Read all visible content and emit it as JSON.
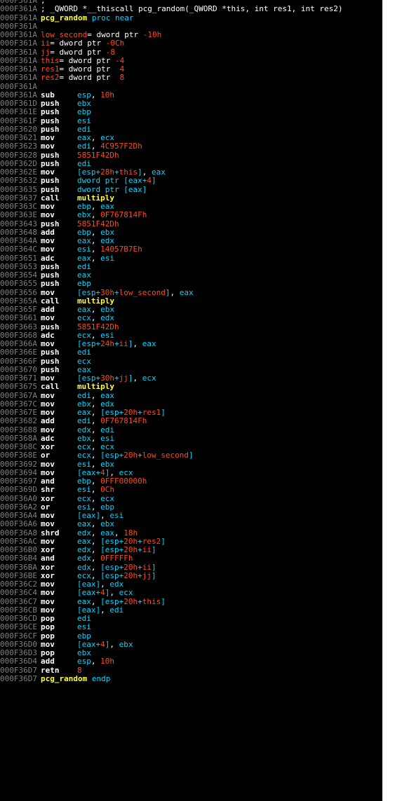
{
  "window": {
    "title": ""
  },
  "colors": {
    "background": "#000000",
    "address": "#808080",
    "mnemonic": "#ffffff",
    "register": "#00d7ff",
    "number": "#ff4a1a",
    "variable": "#ff4a1a",
    "function": "#ffff33"
  },
  "lines": [
    {
      "addr": "000F361A",
      "parts": [
        [
          "txt",
          ";"
        ]
      ]
    },
    {
      "addr": "000F361A",
      "parts": [
        [
          "txt",
          "; _QWORD *__thiscall pcg_random(_QWORD *this, int res1, int res2)"
        ]
      ]
    },
    {
      "addr": "000F361A",
      "parts": [
        [
          "func",
          "pcg_random"
        ],
        [
          "kw",
          " proc near"
        ]
      ]
    },
    {
      "addr": "000F361A",
      "parts": []
    },
    {
      "addr": "000F361A",
      "parts": [
        [
          "var",
          "low_second"
        ],
        [
          "txt",
          "= dword ptr "
        ],
        [
          "num",
          "-10h"
        ]
      ]
    },
    {
      "addr": "000F361A",
      "parts": [
        [
          "var",
          "ii"
        ],
        [
          "txt",
          "= dword ptr "
        ],
        [
          "num",
          "-0Ch"
        ]
      ]
    },
    {
      "addr": "000F361A",
      "parts": [
        [
          "var",
          "jj"
        ],
        [
          "txt",
          "= dword ptr "
        ],
        [
          "num",
          "-8"
        ]
      ]
    },
    {
      "addr": "000F361A",
      "parts": [
        [
          "var",
          "this"
        ],
        [
          "txt",
          "= dword ptr "
        ],
        [
          "num",
          "-4"
        ]
      ]
    },
    {
      "addr": "000F361A",
      "parts": [
        [
          "var",
          "res1"
        ],
        [
          "txt",
          "= dword ptr  "
        ],
        [
          "num",
          "4"
        ]
      ]
    },
    {
      "addr": "000F361A",
      "parts": [
        [
          "var",
          "res2"
        ],
        [
          "txt",
          "= dword ptr  "
        ],
        [
          "num",
          "8"
        ]
      ]
    },
    {
      "addr": "000F361A",
      "parts": []
    },
    {
      "addr": "000F361A",
      "mnem": "sub",
      "ops": [
        [
          "reg",
          "esp"
        ],
        [
          "sep",
          ", "
        ],
        [
          "num",
          "10h"
        ]
      ]
    },
    {
      "addr": "000F361D",
      "mnem": "push",
      "ops": [
        [
          "reg",
          "ebx"
        ]
      ]
    },
    {
      "addr": "000F361E",
      "mnem": "push",
      "ops": [
        [
          "reg",
          "ebp"
        ]
      ]
    },
    {
      "addr": "000F361F",
      "mnem": "push",
      "ops": [
        [
          "reg",
          "esi"
        ]
      ]
    },
    {
      "addr": "000F3620",
      "mnem": "push",
      "ops": [
        [
          "reg",
          "edi"
        ]
      ]
    },
    {
      "addr": "000F3621",
      "mnem": "mov",
      "ops": [
        [
          "reg",
          "eax"
        ],
        [
          "sep",
          ", "
        ],
        [
          "reg",
          "ecx"
        ]
      ]
    },
    {
      "addr": "000F3623",
      "mnem": "mov",
      "ops": [
        [
          "reg",
          "edi"
        ],
        [
          "sep",
          ", "
        ],
        [
          "num",
          "4C957F2Dh"
        ]
      ]
    },
    {
      "addr": "000F3628",
      "mnem": "push",
      "ops": [
        [
          "num",
          "5851F42Dh"
        ]
      ]
    },
    {
      "addr": "000F362D",
      "mnem": "push",
      "ops": [
        [
          "reg",
          "edi"
        ]
      ]
    },
    {
      "addr": "000F362E",
      "mnem": "mov",
      "ops": [
        [
          "reg",
          "[esp+"
        ],
        [
          "num",
          "28h"
        ],
        [
          "reg",
          "+"
        ],
        [
          "var",
          "this"
        ],
        [
          "reg",
          "]"
        ],
        [
          "sep",
          ", "
        ],
        [
          "reg",
          "eax"
        ]
      ]
    },
    {
      "addr": "000F3632",
      "mnem": "push",
      "ops": [
        [
          "reg",
          "dword ptr [eax+"
        ],
        [
          "num",
          "4"
        ],
        [
          "reg",
          "]"
        ]
      ]
    },
    {
      "addr": "000F3635",
      "mnem": "push",
      "ops": [
        [
          "reg",
          "dword ptr [eax]"
        ]
      ]
    },
    {
      "addr": "000F3637",
      "mnem": "call",
      "ops": [
        [
          "func",
          "multiply"
        ]
      ]
    },
    {
      "addr": "000F363C",
      "mnem": "mov",
      "ops": [
        [
          "reg",
          "ebp"
        ],
        [
          "sep",
          ", "
        ],
        [
          "reg",
          "eax"
        ]
      ]
    },
    {
      "addr": "000F363E",
      "mnem": "mov",
      "ops": [
        [
          "reg",
          "ebx"
        ],
        [
          "sep",
          ", "
        ],
        [
          "num",
          "0F767814Fh"
        ]
      ]
    },
    {
      "addr": "000F3643",
      "mnem": "push",
      "ops": [
        [
          "num",
          "5851F42Dh"
        ]
      ]
    },
    {
      "addr": "000F3648",
      "mnem": "add",
      "ops": [
        [
          "reg",
          "ebp"
        ],
        [
          "sep",
          ", "
        ],
        [
          "reg",
          "ebx"
        ]
      ]
    },
    {
      "addr": "000F364A",
      "mnem": "mov",
      "ops": [
        [
          "reg",
          "eax"
        ],
        [
          "sep",
          ", "
        ],
        [
          "reg",
          "edx"
        ]
      ]
    },
    {
      "addr": "000F364C",
      "mnem": "mov",
      "ops": [
        [
          "reg",
          "esi"
        ],
        [
          "sep",
          ", "
        ],
        [
          "num",
          "14057B7Eh"
        ]
      ]
    },
    {
      "addr": "000F3651",
      "mnem": "adc",
      "ops": [
        [
          "reg",
          "eax"
        ],
        [
          "sep",
          ", "
        ],
        [
          "reg",
          "esi"
        ]
      ]
    },
    {
      "addr": "000F3653",
      "mnem": "push",
      "ops": [
        [
          "reg",
          "edi"
        ]
      ]
    },
    {
      "addr": "000F3654",
      "mnem": "push",
      "ops": [
        [
          "reg",
          "eax"
        ]
      ]
    },
    {
      "addr": "000F3655",
      "mnem": "push",
      "ops": [
        [
          "reg",
          "ebp"
        ]
      ]
    },
    {
      "addr": "000F3656",
      "mnem": "mov",
      "ops": [
        [
          "reg",
          "[esp+"
        ],
        [
          "num",
          "30h"
        ],
        [
          "reg",
          "+"
        ],
        [
          "var",
          "low_second"
        ],
        [
          "reg",
          "]"
        ],
        [
          "sep",
          ", "
        ],
        [
          "reg",
          "eax"
        ]
      ]
    },
    {
      "addr": "000F365A",
      "mnem": "call",
      "ops": [
        [
          "func",
          "multiply"
        ]
      ]
    },
    {
      "addr": "000F365F",
      "mnem": "add",
      "ops": [
        [
          "reg",
          "eax"
        ],
        [
          "sep",
          ", "
        ],
        [
          "reg",
          "ebx"
        ]
      ]
    },
    {
      "addr": "000F3661",
      "mnem": "mov",
      "ops": [
        [
          "reg",
          "ecx"
        ],
        [
          "sep",
          ", "
        ],
        [
          "reg",
          "edx"
        ]
      ]
    },
    {
      "addr": "000F3663",
      "mnem": "push",
      "ops": [
        [
          "num",
          "5851F42Dh"
        ]
      ]
    },
    {
      "addr": "000F3668",
      "mnem": "adc",
      "ops": [
        [
          "reg",
          "ecx"
        ],
        [
          "sep",
          ", "
        ],
        [
          "reg",
          "esi"
        ]
      ]
    },
    {
      "addr": "000F366A",
      "mnem": "mov",
      "ops": [
        [
          "reg",
          "[esp+"
        ],
        [
          "num",
          "24h"
        ],
        [
          "reg",
          "+"
        ],
        [
          "var",
          "ii"
        ],
        [
          "reg",
          "]"
        ],
        [
          "sep",
          ", "
        ],
        [
          "reg",
          "eax"
        ]
      ]
    },
    {
      "addr": "000F366E",
      "mnem": "push",
      "ops": [
        [
          "reg",
          "edi"
        ]
      ]
    },
    {
      "addr": "000F366F",
      "mnem": "push",
      "ops": [
        [
          "reg",
          "ecx"
        ]
      ]
    },
    {
      "addr": "000F3670",
      "mnem": "push",
      "ops": [
        [
          "reg",
          "eax"
        ]
      ]
    },
    {
      "addr": "000F3671",
      "mnem": "mov",
      "ops": [
        [
          "reg",
          "[esp+"
        ],
        [
          "num",
          "30h"
        ],
        [
          "reg",
          "+"
        ],
        [
          "var",
          "jj"
        ],
        [
          "reg",
          "]"
        ],
        [
          "sep",
          ", "
        ],
        [
          "reg",
          "ecx"
        ]
      ]
    },
    {
      "addr": "000F3675",
      "mnem": "call",
      "ops": [
        [
          "func",
          "multiply"
        ]
      ]
    },
    {
      "addr": "000F367A",
      "mnem": "mov",
      "ops": [
        [
          "reg",
          "edi"
        ],
        [
          "sep",
          ", "
        ],
        [
          "reg",
          "eax"
        ]
      ]
    },
    {
      "addr": "000F367C",
      "mnem": "mov",
      "ops": [
        [
          "reg",
          "ebx"
        ],
        [
          "sep",
          ", "
        ],
        [
          "reg",
          "edx"
        ]
      ]
    },
    {
      "addr": "000F367E",
      "mnem": "mov",
      "ops": [
        [
          "reg",
          "eax"
        ],
        [
          "sep",
          ", "
        ],
        [
          "reg",
          "[esp+"
        ],
        [
          "num",
          "20h"
        ],
        [
          "reg",
          "+"
        ],
        [
          "var",
          "res1"
        ],
        [
          "reg",
          "]"
        ]
      ]
    },
    {
      "addr": "000F3682",
      "mnem": "add",
      "ops": [
        [
          "reg",
          "edi"
        ],
        [
          "sep",
          ", "
        ],
        [
          "num",
          "0F767814Fh"
        ]
      ]
    },
    {
      "addr": "000F3688",
      "mnem": "mov",
      "ops": [
        [
          "reg",
          "edx"
        ],
        [
          "sep",
          ", "
        ],
        [
          "reg",
          "edi"
        ]
      ]
    },
    {
      "addr": "000F368A",
      "mnem": "adc",
      "ops": [
        [
          "reg",
          "ebx"
        ],
        [
          "sep",
          ", "
        ],
        [
          "reg",
          "esi"
        ]
      ]
    },
    {
      "addr": "000F368C",
      "mnem": "xor",
      "ops": [
        [
          "reg",
          "ecx"
        ],
        [
          "sep",
          ", "
        ],
        [
          "reg",
          "ecx"
        ]
      ]
    },
    {
      "addr": "000F368E",
      "mnem": "or",
      "ops": [
        [
          "reg",
          "ecx"
        ],
        [
          "sep",
          ", "
        ],
        [
          "reg",
          "[esp+"
        ],
        [
          "num",
          "20h"
        ],
        [
          "reg",
          "+"
        ],
        [
          "var",
          "low_second"
        ],
        [
          "reg",
          "]"
        ]
      ]
    },
    {
      "addr": "000F3692",
      "mnem": "mov",
      "ops": [
        [
          "reg",
          "esi"
        ],
        [
          "sep",
          ", "
        ],
        [
          "reg",
          "ebx"
        ]
      ]
    },
    {
      "addr": "000F3694",
      "mnem": "mov",
      "ops": [
        [
          "reg",
          "[eax+"
        ],
        [
          "num",
          "4"
        ],
        [
          "reg",
          "]"
        ],
        [
          "sep",
          ", "
        ],
        [
          "reg",
          "ecx"
        ]
      ]
    },
    {
      "addr": "000F3697",
      "mnem": "and",
      "ops": [
        [
          "reg",
          "ebp"
        ],
        [
          "sep",
          ", "
        ],
        [
          "num",
          "0FFF00000h"
        ]
      ]
    },
    {
      "addr": "000F369D",
      "mnem": "shr",
      "ops": [
        [
          "reg",
          "esi"
        ],
        [
          "sep",
          ", "
        ],
        [
          "num",
          "0Ch"
        ]
      ]
    },
    {
      "addr": "000F36A0",
      "mnem": "xor",
      "ops": [
        [
          "reg",
          "ecx"
        ],
        [
          "sep",
          ", "
        ],
        [
          "reg",
          "ecx"
        ]
      ]
    },
    {
      "addr": "000F36A2",
      "mnem": "or",
      "ops": [
        [
          "reg",
          "esi"
        ],
        [
          "sep",
          ", "
        ],
        [
          "reg",
          "ebp"
        ]
      ]
    },
    {
      "addr": "000F36A4",
      "mnem": "mov",
      "ops": [
        [
          "reg",
          "[eax]"
        ],
        [
          "sep",
          ", "
        ],
        [
          "reg",
          "esi"
        ]
      ]
    },
    {
      "addr": "000F36A6",
      "mnem": "mov",
      "ops": [
        [
          "reg",
          "eax"
        ],
        [
          "sep",
          ", "
        ],
        [
          "reg",
          "ebx"
        ]
      ]
    },
    {
      "addr": "000F36A8",
      "mnem": "shrd",
      "ops": [
        [
          "reg",
          "edx"
        ],
        [
          "sep",
          ", "
        ],
        [
          "reg",
          "eax"
        ],
        [
          "sep",
          ", "
        ],
        [
          "num",
          "18h"
        ]
      ]
    },
    {
      "addr": "000F36AC",
      "mnem": "mov",
      "ops": [
        [
          "reg",
          "eax"
        ],
        [
          "sep",
          ", "
        ],
        [
          "reg",
          "[esp+"
        ],
        [
          "num",
          "20h"
        ],
        [
          "reg",
          "+"
        ],
        [
          "var",
          "res2"
        ],
        [
          "reg",
          "]"
        ]
      ]
    },
    {
      "addr": "000F36B0",
      "mnem": "xor",
      "ops": [
        [
          "reg",
          "edx"
        ],
        [
          "sep",
          ", "
        ],
        [
          "reg",
          "[esp+"
        ],
        [
          "num",
          "20h"
        ],
        [
          "reg",
          "+"
        ],
        [
          "var",
          "ii"
        ],
        [
          "reg",
          "]"
        ]
      ]
    },
    {
      "addr": "000F36B4",
      "mnem": "and",
      "ops": [
        [
          "reg",
          "edx"
        ],
        [
          "sep",
          ", "
        ],
        [
          "num",
          "0FFFFFh"
        ]
      ]
    },
    {
      "addr": "000F36BA",
      "mnem": "xor",
      "ops": [
        [
          "reg",
          "edx"
        ],
        [
          "sep",
          ", "
        ],
        [
          "reg",
          "[esp+"
        ],
        [
          "num",
          "20h"
        ],
        [
          "reg",
          "+"
        ],
        [
          "var",
          "ii"
        ],
        [
          "reg",
          "]"
        ]
      ]
    },
    {
      "addr": "000F36BE",
      "mnem": "xor",
      "ops": [
        [
          "reg",
          "ecx"
        ],
        [
          "sep",
          ", "
        ],
        [
          "reg",
          "[esp+"
        ],
        [
          "num",
          "20h"
        ],
        [
          "reg",
          "+"
        ],
        [
          "var",
          "jj"
        ],
        [
          "reg",
          "]"
        ]
      ]
    },
    {
      "addr": "000F36C2",
      "mnem": "mov",
      "ops": [
        [
          "reg",
          "[eax]"
        ],
        [
          "sep",
          ", "
        ],
        [
          "reg",
          "edx"
        ]
      ]
    },
    {
      "addr": "000F36C4",
      "mnem": "mov",
      "ops": [
        [
          "reg",
          "[eax+"
        ],
        [
          "num",
          "4"
        ],
        [
          "reg",
          "]"
        ],
        [
          "sep",
          ", "
        ],
        [
          "reg",
          "ecx"
        ]
      ]
    },
    {
      "addr": "000F36C7",
      "mnem": "mov",
      "ops": [
        [
          "reg",
          "eax"
        ],
        [
          "sep",
          ", "
        ],
        [
          "reg",
          "[esp+"
        ],
        [
          "num",
          "20h"
        ],
        [
          "reg",
          "+"
        ],
        [
          "var",
          "this"
        ],
        [
          "reg",
          "]"
        ]
      ]
    },
    {
      "addr": "000F36CB",
      "mnem": "mov",
      "ops": [
        [
          "reg",
          "[eax]"
        ],
        [
          "sep",
          ", "
        ],
        [
          "reg",
          "edi"
        ]
      ]
    },
    {
      "addr": "000F36CD",
      "mnem": "pop",
      "ops": [
        [
          "reg",
          "edi"
        ]
      ]
    },
    {
      "addr": "000F36CE",
      "mnem": "pop",
      "ops": [
        [
          "reg",
          "esi"
        ]
      ]
    },
    {
      "addr": "000F36CF",
      "mnem": "pop",
      "ops": [
        [
          "reg",
          "ebp"
        ]
      ]
    },
    {
      "addr": "000F36D0",
      "mnem": "mov",
      "ops": [
        [
          "reg",
          "[eax+"
        ],
        [
          "num",
          "4"
        ],
        [
          "reg",
          "]"
        ],
        [
          "sep",
          ", "
        ],
        [
          "reg",
          "ebx"
        ]
      ]
    },
    {
      "addr": "000F36D3",
      "mnem": "pop",
      "ops": [
        [
          "reg",
          "ebx"
        ]
      ]
    },
    {
      "addr": "000F36D4",
      "mnem": "add",
      "ops": [
        [
          "reg",
          "esp"
        ],
        [
          "sep",
          ", "
        ],
        [
          "num",
          "10h"
        ]
      ]
    },
    {
      "addr": "000F36D7",
      "mnem": "retn",
      "ops": [
        [
          "num",
          "8"
        ]
      ]
    },
    {
      "addr": "000F36D7",
      "parts": [
        [
          "func",
          "pcg_random"
        ],
        [
          "kw",
          " endp"
        ]
      ]
    }
  ]
}
